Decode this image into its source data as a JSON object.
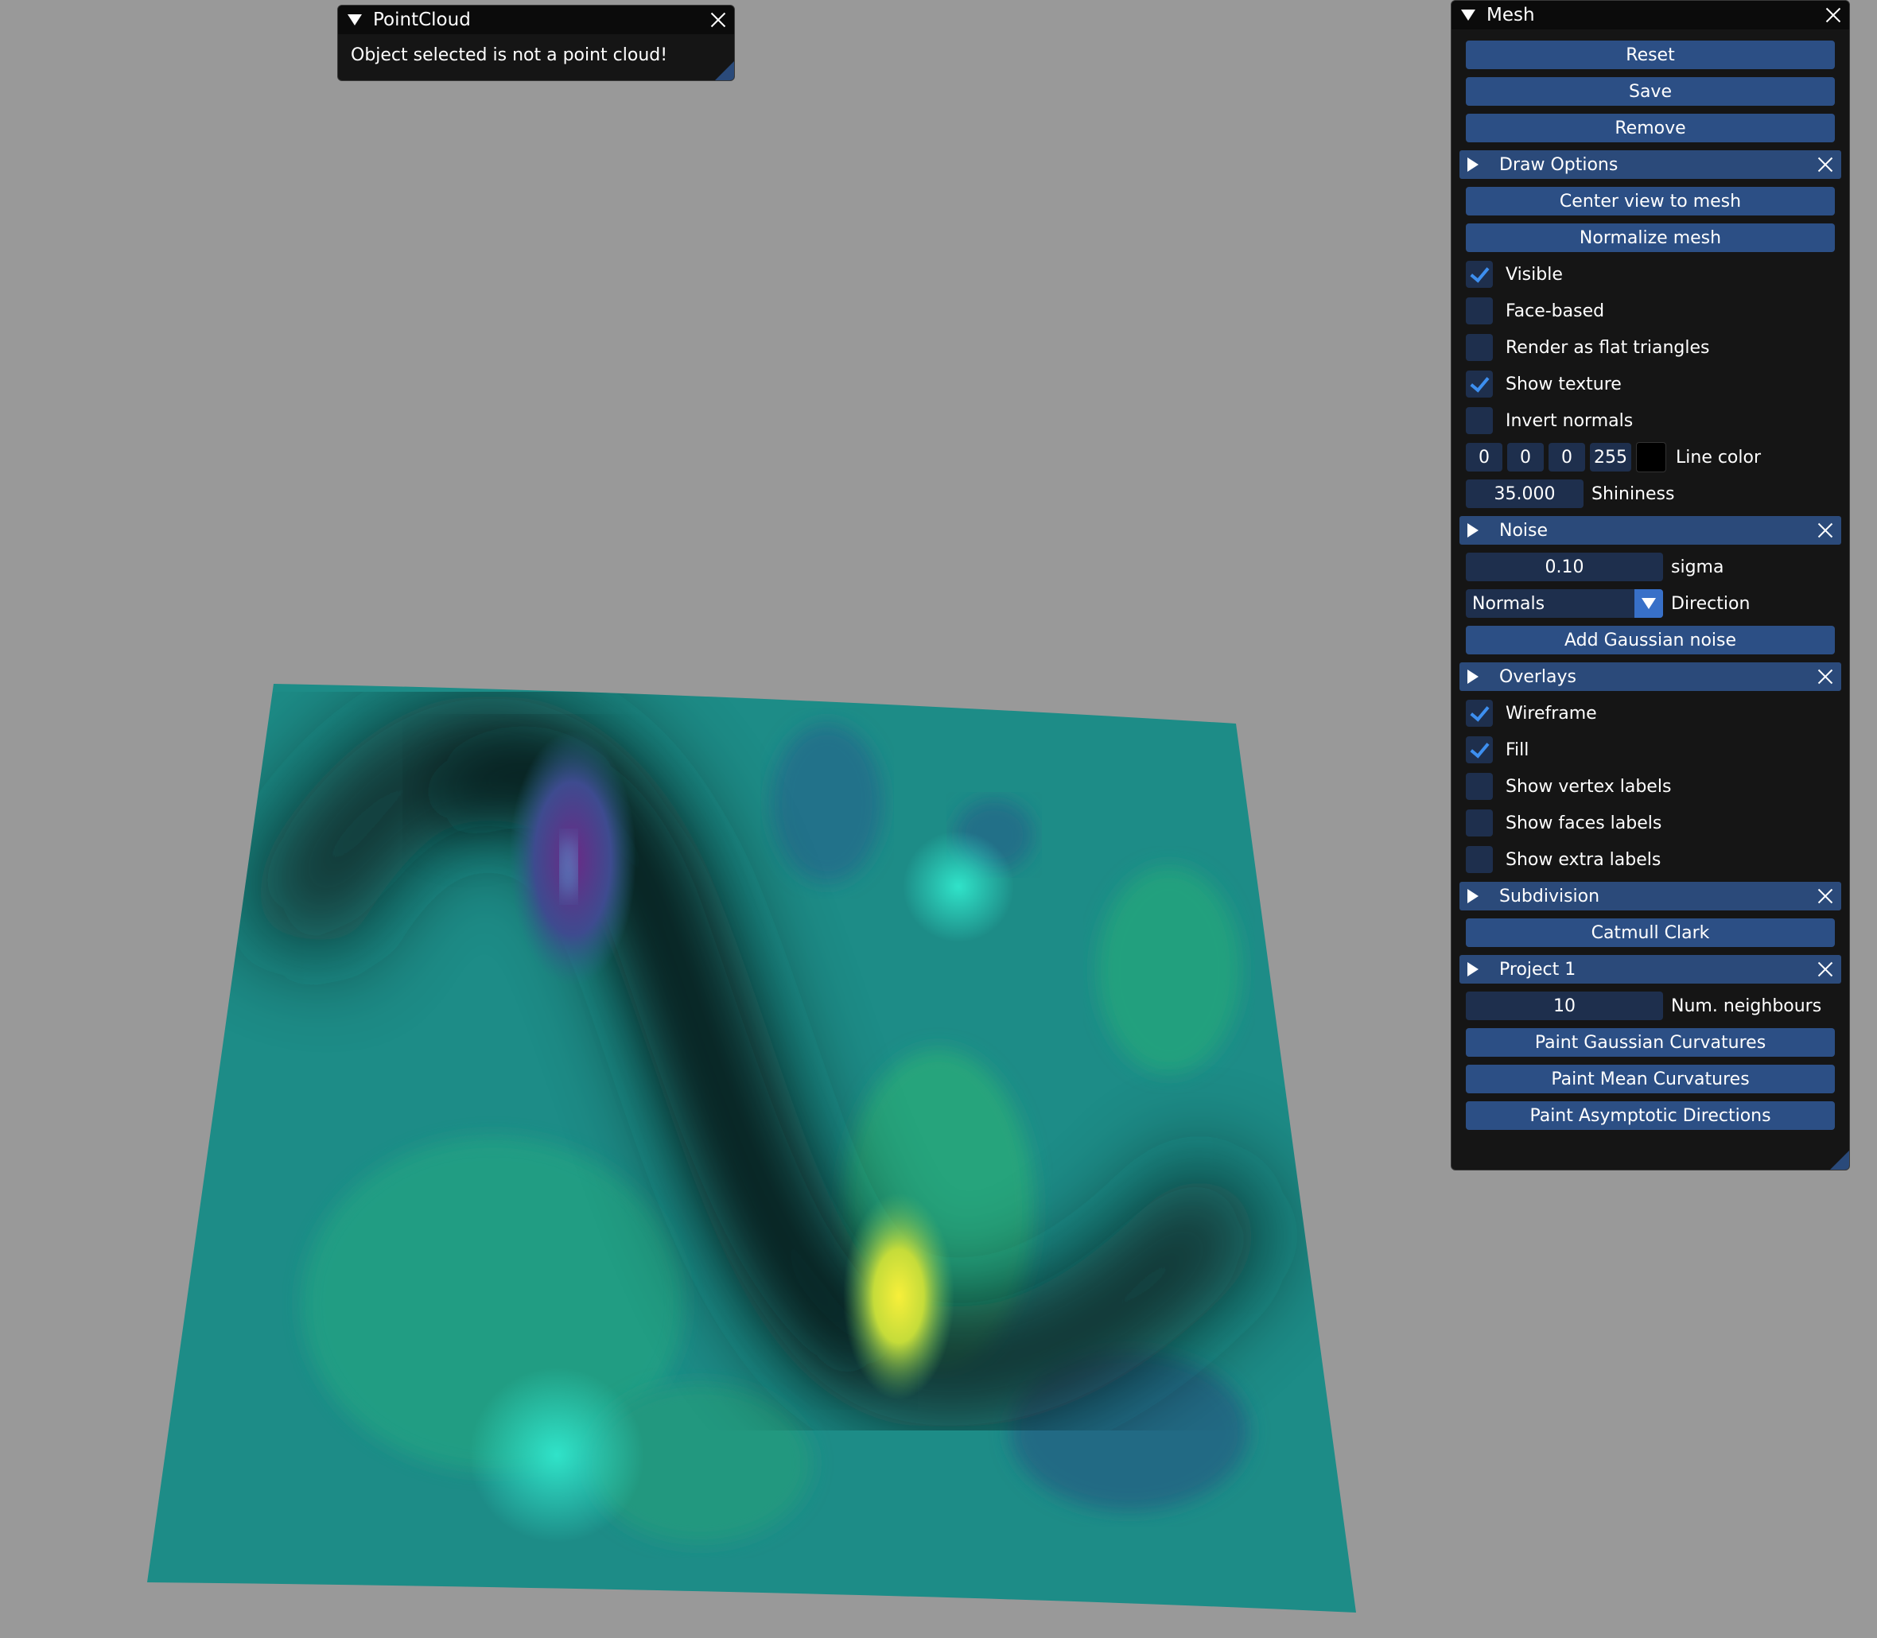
{
  "pointcloud_window": {
    "title": "PointCloud",
    "message": "Object selected is not a point cloud!"
  },
  "mesh_window": {
    "title": "Mesh",
    "buttons": {
      "reset": "Reset",
      "save": "Save",
      "remove": "Remove"
    },
    "draw_options": {
      "title": "Draw Options",
      "center_view": "Center view to mesh",
      "normalize": "Normalize mesh",
      "visible": {
        "label": "Visible",
        "checked": true
      },
      "face_based": {
        "label": "Face-based",
        "checked": false
      },
      "flat_triangles": {
        "label": "Render as flat triangles",
        "checked": false
      },
      "show_texture": {
        "label": "Show texture",
        "checked": true
      },
      "invert_normals": {
        "label": "Invert normals",
        "checked": false
      },
      "line_color": {
        "r": "0",
        "g": "0",
        "b": "0",
        "a": "255",
        "label": "Line color",
        "swatch": "#000000"
      },
      "shininess": {
        "value": "35.000",
        "label": "Shininess"
      }
    },
    "noise": {
      "title": "Noise",
      "sigma": {
        "value": "0.10",
        "label": "sigma"
      },
      "direction": {
        "value": "Normals",
        "label": "Direction"
      },
      "add_button": "Add Gaussian noise"
    },
    "overlays": {
      "title": "Overlays",
      "wireframe": {
        "label": "Wireframe",
        "checked": true
      },
      "fill": {
        "label": "Fill",
        "checked": true
      },
      "vertex_labels": {
        "label": "Show vertex labels",
        "checked": false
      },
      "faces_labels": {
        "label": "Show faces labels",
        "checked": false
      },
      "extra_labels": {
        "label": "Show extra labels",
        "checked": false
      }
    },
    "subdivision": {
      "title": "Subdivision",
      "catmull": "Catmull Clark"
    },
    "project": {
      "title": "Project 1",
      "neighbours": {
        "value": "10",
        "label": "Num. neighbours"
      },
      "gaussian": "Paint Gaussian Curvatures",
      "mean": "Paint Mean Curvatures",
      "asymptotic": "Paint Asymptotic Directions"
    }
  },
  "colors": {
    "background": "#999999",
    "panel": "#151515",
    "button": "#2c4f85",
    "header": "#2b4a7a",
    "checkmark": "#3d8ff0",
    "mesh_base": "#1e8e88"
  }
}
